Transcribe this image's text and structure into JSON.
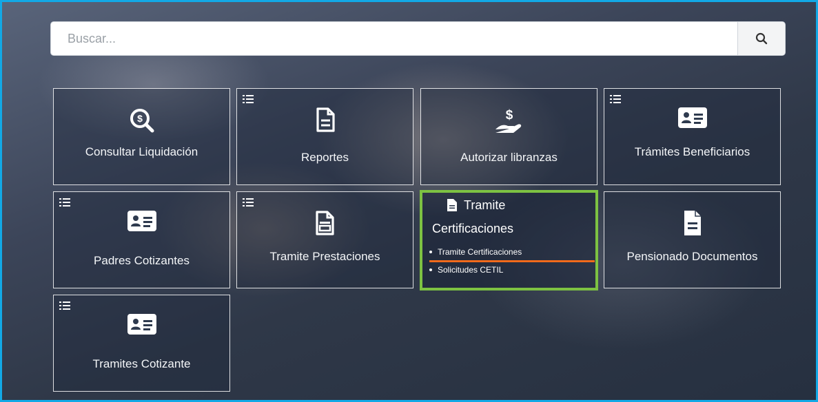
{
  "search": {
    "placeholder": "Buscar...",
    "icon": "search-icon"
  },
  "tiles": [
    {
      "label": "Consultar Liquidación",
      "icon": "money-search-icon"
    },
    {
      "label": "Reportes",
      "icon": "document-icon"
    },
    {
      "label": "Autorizar libranzas",
      "icon": "hand-money-icon"
    },
    {
      "label": "Trámites Beneficiarios",
      "icon": "id-card-icon"
    },
    {
      "label": "Padres Cotizantes",
      "icon": "id-card-icon"
    },
    {
      "label": "Tramite Prestaciones",
      "icon": "documents-icon"
    },
    {
      "label": "Pensionado Documentos",
      "icon": "document-icon"
    },
    {
      "label": "Tramites Cotizante",
      "icon": "id-card-icon"
    }
  ],
  "cert_tile": {
    "title_line1": "Tramite",
    "title_line2": "Certificaciones",
    "submenu": [
      "Tramite Certificaciones",
      "Solicitudes CETIL"
    ],
    "highlight_color": "#7dc242",
    "underline_color": "#f26a1b"
  },
  "colors": {
    "frame_border": "#12a9e6"
  }
}
